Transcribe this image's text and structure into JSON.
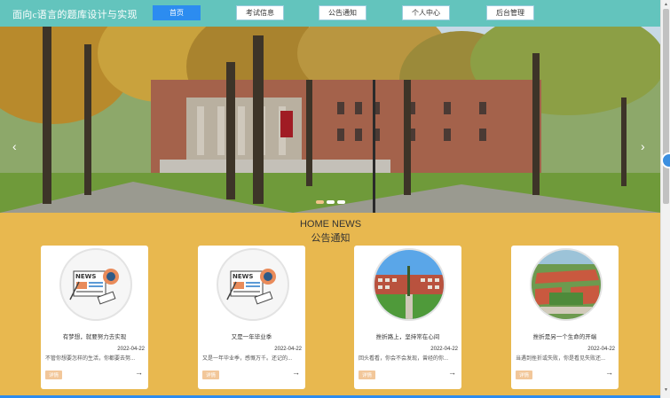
{
  "header": {
    "title": "面向c语言的题库设计与实现",
    "nav": [
      {
        "label": "首页",
        "active": true
      },
      {
        "label": "考试信息",
        "active": false
      },
      {
        "label": "公告通知",
        "active": false
      },
      {
        "label": "个人中心",
        "active": false
      },
      {
        "label": "后台管理",
        "active": false
      }
    ]
  },
  "banner": {
    "prev_icon": "chevron-left",
    "next_icon": "chevron-right",
    "slide_count": 3,
    "active_slide": 1
  },
  "section": {
    "heading_en": "HOME NEWS",
    "heading_cn": "公告通知"
  },
  "cards": [
    {
      "title": "有梦想，就要努力去实现",
      "date": "2022-04-22",
      "desc": "不管你想要怎样的生活，你都要去努...",
      "tag": "详情",
      "image": "news-icon"
    },
    {
      "title": "又是一年毕业季",
      "date": "2022-04-22",
      "desc": "又是一年毕业季，感慨万千。还记的...",
      "tag": "详情",
      "image": "news-icon"
    },
    {
      "title": "挫折路上，坚持常在心间",
      "date": "2022-04-22",
      "desc": "回头看看，你会不会发现，曾经的你...",
      "tag": "详情",
      "image": "campus-photo"
    },
    {
      "title": "挫折是另一个生命的开端",
      "date": "2022-04-22",
      "desc": "当遇到挫折或失败，你是看见失败还...",
      "tag": "详情",
      "image": "campus-aerial-photo"
    }
  ],
  "colors": {
    "topbar": "#63c4bd",
    "page_bg": "#e8b84f",
    "nav_active": "#2c8cf0",
    "tag_bg": "#f2c79a"
  }
}
